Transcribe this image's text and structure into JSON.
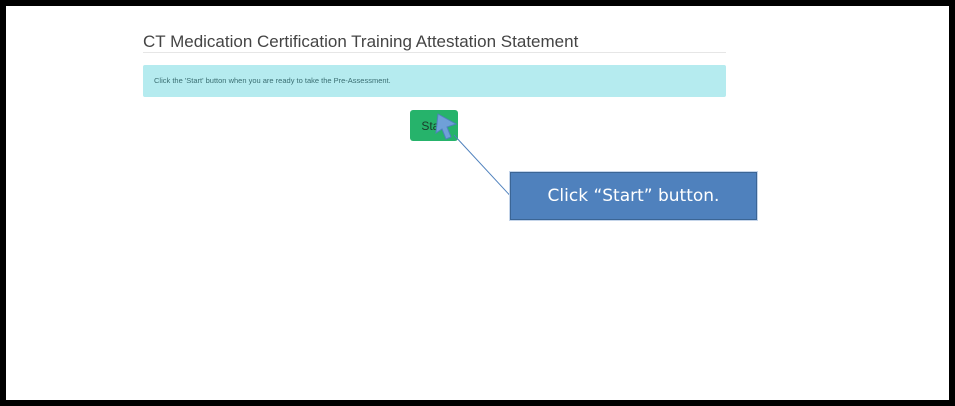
{
  "page": {
    "title": "CT Medication Certification Training Attestation Statement",
    "info_message": "Click the 'Start' button when you are ready to take the Pre-Assessment."
  },
  "actions": {
    "start_label": "Start"
  },
  "annotation": {
    "callout_text": "Click “Start” button."
  },
  "colors": {
    "banner_bg": "#b5ebef",
    "start_button": "#26b36b",
    "callout_bg": "#4f81bd",
    "frame_border": "#000000"
  }
}
